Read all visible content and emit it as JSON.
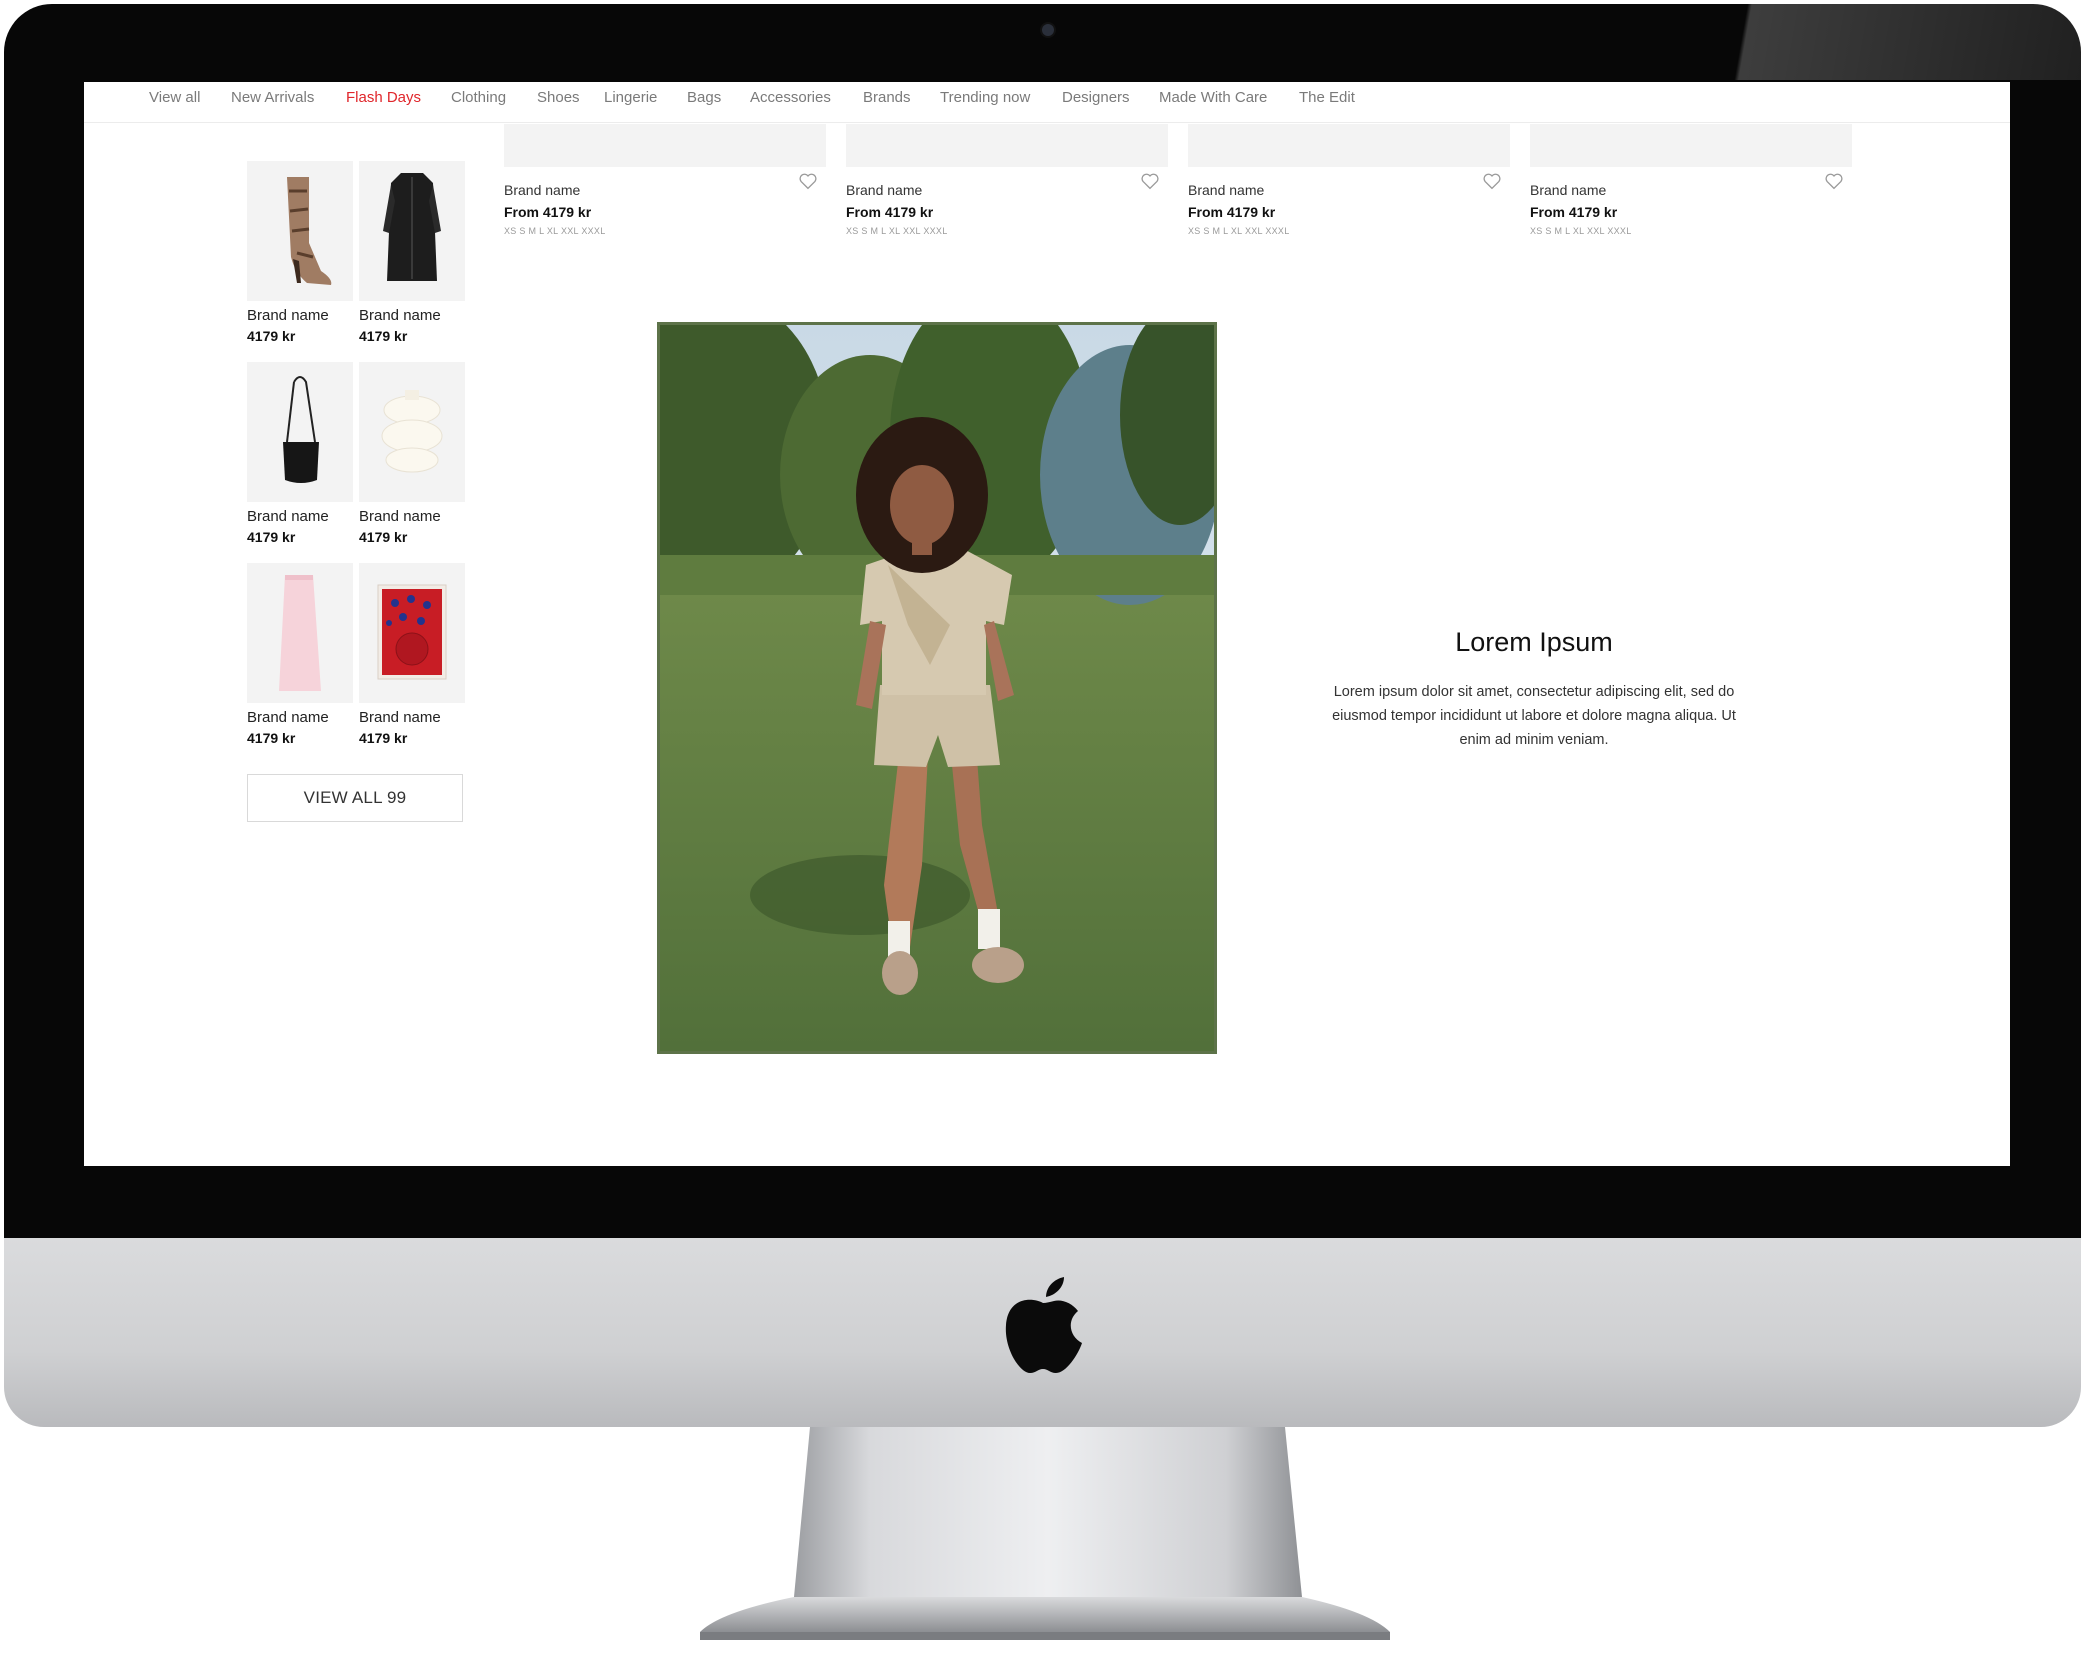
{
  "nav": {
    "items": [
      {
        "label": "View all",
        "active": false
      },
      {
        "label": "New Arrivals",
        "active": false
      },
      {
        "label": "Flash Days",
        "active": true
      },
      {
        "label": "Clothing",
        "active": false
      },
      {
        "label": "Shoes",
        "active": false
      },
      {
        "label": "Lingerie",
        "active": false
      },
      {
        "label": "Bags",
        "active": false
      },
      {
        "label": "Accessories",
        "active": false
      },
      {
        "label": "Brands",
        "active": false
      },
      {
        "label": "Trending now",
        "active": false
      },
      {
        "label": "Designers",
        "active": false
      },
      {
        "label": "Made With Care",
        "active": false
      },
      {
        "label": "The Edit",
        "active": false
      }
    ],
    "active_color": "#e0262b"
  },
  "top_products": [
    {
      "brand": "Brand name",
      "price": "From 4179 kr",
      "sizes": "XS S M L XL XXL XXXL"
    },
    {
      "brand": "Brand name",
      "price": "From 4179 kr",
      "sizes": "XS S M L XL XXL XXXL"
    },
    {
      "brand": "Brand name",
      "price": "From 4179 kr",
      "sizes": "XS S M L XL XXL XXXL"
    },
    {
      "brand": "Brand name",
      "price": "From 4179 kr",
      "sizes": "XS S M L XL XXL XXXL"
    }
  ],
  "mini_products": [
    {
      "brand": "Brand name",
      "price": "4179 kr",
      "icon": "boot-icon"
    },
    {
      "brand": "Brand name",
      "price": "4179 kr",
      "icon": "coat-icon"
    },
    {
      "brand": "Brand name",
      "price": "4179 kr",
      "icon": "bucket-bag-icon"
    },
    {
      "brand": "Brand name",
      "price": "4179 kr",
      "icon": "vase-icon"
    },
    {
      "brand": "Brand name",
      "price": "4179 kr",
      "icon": "skirt-icon"
    },
    {
      "brand": "Brand name",
      "price": "4179 kr",
      "icon": "art-print-icon"
    }
  ],
  "view_all_label": "VIEW ALL 99",
  "editorial": {
    "title": "Lorem Ipsum",
    "body": "Lorem ipsum dolor sit amet, consectetur adipiscing elit, sed do eiusmod tempor incididunt ut labore et dolore magna aliqua. Ut enim ad minim veniam."
  },
  "device": {
    "logo": "apple-logo-icon"
  }
}
